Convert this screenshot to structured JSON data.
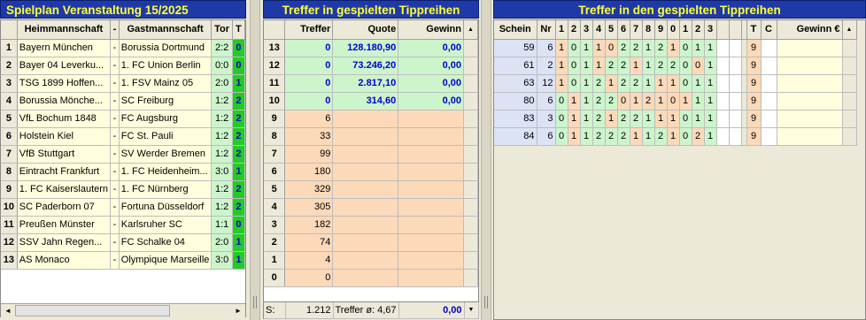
{
  "left_panel": {
    "title": "Spielplan Veranstaltung 15/2025",
    "headers": {
      "rownum": "",
      "home": "Heimmannschaft",
      "dash": "-",
      "away": "Gastmannschaft",
      "score": "Tor",
      "tip": "T"
    },
    "rows": [
      {
        "n": "1",
        "home": "Bayern München",
        "dash": "-",
        "away": "Borussia Dortmund",
        "score": "2:2",
        "tip": "0"
      },
      {
        "n": "2",
        "home": "Bayer 04 Leverku...",
        "dash": "-",
        "away": "1. FC Union Berlin",
        "score": "0:0",
        "tip": "0"
      },
      {
        "n": "3",
        "home": "TSG 1899 Hoffen...",
        "dash": "-",
        "away": "1. FSV Mainz 05",
        "score": "2:0",
        "tip": "1"
      },
      {
        "n": "4",
        "home": "Borussia Mönche...",
        "dash": "-",
        "away": "SC Freiburg",
        "score": "1:2",
        "tip": "2"
      },
      {
        "n": "5",
        "home": "VfL Bochum 1848",
        "dash": "-",
        "away": "FC Augsburg",
        "score": "1:2",
        "tip": "2"
      },
      {
        "n": "6",
        "home": "Holstein Kiel",
        "dash": "-",
        "away": "FC St. Pauli",
        "score": "1:2",
        "tip": "2"
      },
      {
        "n": "7",
        "home": "VfB Stuttgart",
        "dash": "-",
        "away": "SV Werder Bremen",
        "score": "1:2",
        "tip": "2"
      },
      {
        "n": "8",
        "home": "Eintracht Frankfurt",
        "dash": "-",
        "away": "1. FC Heidenheim...",
        "score": "3:0",
        "tip": "1"
      },
      {
        "n": "9",
        "home": "1. FC Kaiserslautern",
        "dash": "-",
        "away": "1. FC Nürnberg",
        "score": "1:2",
        "tip": "2"
      },
      {
        "n": "10",
        "home": "SC Paderborn 07",
        "dash": "-",
        "away": "Fortuna Düsseldorf",
        "score": "1:2",
        "tip": "2"
      },
      {
        "n": "11",
        "home": "Preußen Münster",
        "dash": "-",
        "away": "Karlsruher SC",
        "score": "1:1",
        "tip": "0"
      },
      {
        "n": "12",
        "home": "SSV Jahn Regen...",
        "dash": "-",
        "away": "FC Schalke 04",
        "score": "2:0",
        "tip": "1"
      },
      {
        "n": "13",
        "home": "AS Monaco",
        "dash": "-",
        "away": "Olympique Marseille",
        "score": "3:0",
        "tip": "1"
      }
    ],
    "scroll_left": "◄",
    "scroll_right": "►"
  },
  "middle_panel": {
    "title": "Treffer in gespielten Tippreihen",
    "headers": {
      "rank": "",
      "treffer": "Treffer",
      "quote": "Quote",
      "gewinn": "Gewinn"
    },
    "rows": [
      {
        "rank": "13",
        "treffer": "0",
        "quote": "128.180,90",
        "gewinn": "0,00",
        "win": true
      },
      {
        "rank": "12",
        "treffer": "0",
        "quote": "73.246,20",
        "gewinn": "0,00",
        "win": true
      },
      {
        "rank": "11",
        "treffer": "0",
        "quote": "2.817,10",
        "gewinn": "0,00",
        "win": true
      },
      {
        "rank": "10",
        "treffer": "0",
        "quote": "314,60",
        "gewinn": "0,00",
        "win": true
      },
      {
        "rank": "9",
        "treffer": "6",
        "quote": "",
        "gewinn": "",
        "win": false
      },
      {
        "rank": "8",
        "treffer": "33",
        "quote": "",
        "gewinn": "",
        "win": false
      },
      {
        "rank": "7",
        "treffer": "99",
        "quote": "",
        "gewinn": "",
        "win": false
      },
      {
        "rank": "6",
        "treffer": "180",
        "quote": "",
        "gewinn": "",
        "win": false
      },
      {
        "rank": "5",
        "treffer": "329",
        "quote": "",
        "gewinn": "",
        "win": false
      },
      {
        "rank": "4",
        "treffer": "305",
        "quote": "",
        "gewinn": "",
        "win": false
      },
      {
        "rank": "3",
        "treffer": "182",
        "quote": "",
        "gewinn": "",
        "win": false
      },
      {
        "rank": "2",
        "treffer": "74",
        "quote": "",
        "gewinn": "",
        "win": false
      },
      {
        "rank": "1",
        "treffer": "4",
        "quote": "",
        "gewinn": "",
        "win": false
      },
      {
        "rank": "0",
        "treffer": "0",
        "quote": "",
        "gewinn": "",
        "win": false
      }
    ],
    "summary": {
      "label": "S:",
      "total": "1.212",
      "avg_label": "Treffer ø:",
      "avg": "4,67",
      "gewinn": "0,00"
    },
    "scroll_up": "▲",
    "scroll_down": "▼"
  },
  "right_panel": {
    "title": "Treffer in den gespielten Tippreihen",
    "headers": {
      "schein": "Schein",
      "nr": "Nr",
      "tips": [
        "1",
        "2",
        "3",
        "4",
        "5",
        "6",
        "7",
        "8",
        "9",
        "0",
        "1",
        "2",
        "3"
      ],
      "t": "T",
      "c": "C",
      "gewinn": "Gewinn €"
    },
    "rows": [
      {
        "schein": "59",
        "nr": "6",
        "tips": [
          "1",
          "0",
          "1",
          "1",
          "0",
          "2",
          "2",
          "1",
          "2",
          "1",
          "0",
          "1",
          "1"
        ],
        "t": "9"
      },
      {
        "schein": "61",
        "nr": "2",
        "tips": [
          "1",
          "0",
          "1",
          "1",
          "2",
          "2",
          "1",
          "1",
          "2",
          "2",
          "0",
          "0",
          "1"
        ],
        "t": "9"
      },
      {
        "schein": "63",
        "nr": "12",
        "tips": [
          "1",
          "0",
          "1",
          "2",
          "1",
          "2",
          "2",
          "1",
          "1",
          "1",
          "0",
          "1",
          "1"
        ],
        "t": "9"
      },
      {
        "schein": "80",
        "nr": "6",
        "tips": [
          "0",
          "1",
          "1",
          "2",
          "2",
          "0",
          "1",
          "2",
          "1",
          "0",
          "1",
          "1",
          "1"
        ],
        "t": "9"
      },
      {
        "schein": "83",
        "nr": "3",
        "tips": [
          "0",
          "1",
          "1",
          "2",
          "1",
          "2",
          "2",
          "1",
          "1",
          "1",
          "0",
          "1",
          "1"
        ],
        "t": "9"
      },
      {
        "schein": "84",
        "nr": "6",
        "tips": [
          "0",
          "1",
          "1",
          "2",
          "2",
          "2",
          "1",
          "1",
          "2",
          "1",
          "0",
          "2",
          "1"
        ],
        "t": "9"
      }
    ],
    "scroll_up": "▲"
  },
  "colors": {
    "title_bg": "#1f3aa6",
    "title_fg": "#ffff33",
    "cream": "#ffffdd",
    "light_green": "#ccf5cc",
    "peach": "#fcd9b9",
    "hit_green": "#22cc22"
  },
  "results": [
    "0",
    "0",
    "1",
    "2",
    "2",
    "2",
    "2",
    "1",
    "2",
    "2",
    "0",
    "1",
    "1"
  ]
}
